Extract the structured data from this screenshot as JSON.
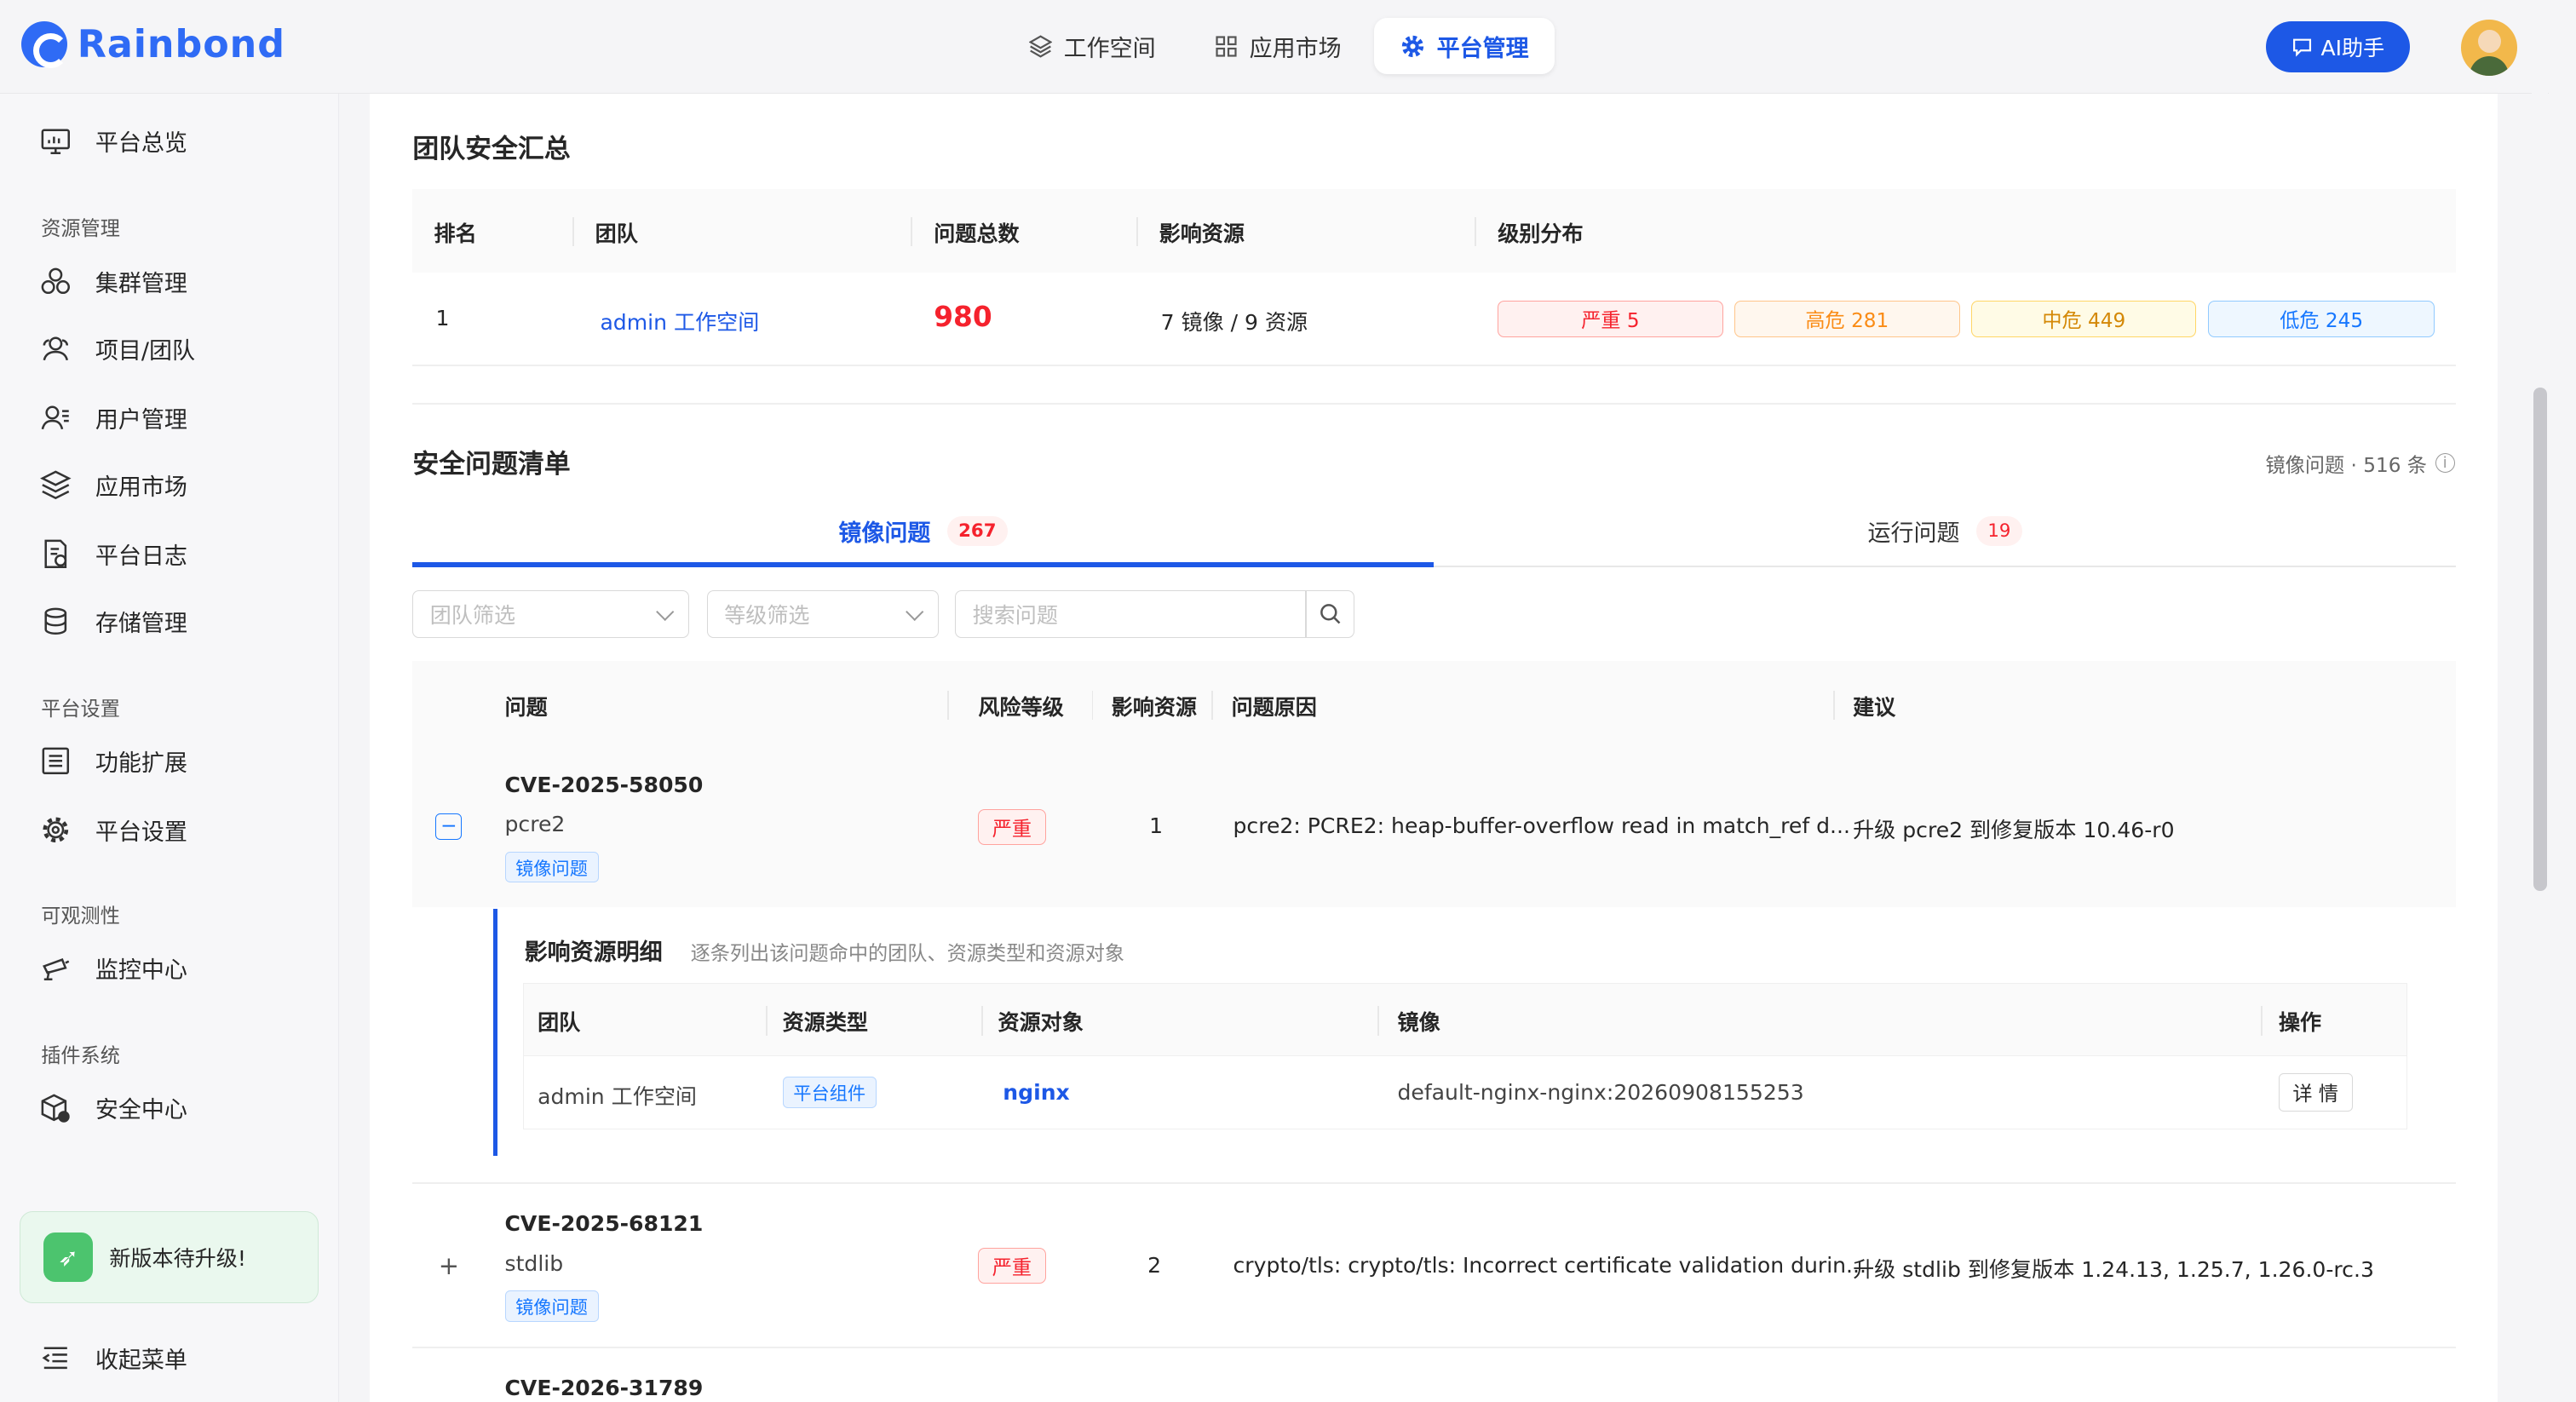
{
  "app": {
    "name": "Rainbond"
  },
  "topnav": [
    {
      "label": "工作空间",
      "icon": "layers-icon",
      "active": false
    },
    {
      "label": "应用市场",
      "icon": "grid-icon",
      "active": false
    },
    {
      "label": "平台管理",
      "icon": "gear-icon",
      "active": true
    }
  ],
  "ai_button": "AI助手",
  "sidebar": {
    "overview": "平台总览",
    "section_resources": "资源管理",
    "cluster": "集群管理",
    "project": "项目/团队",
    "users": "用户管理",
    "market": "应用市场",
    "logs": "平台日志",
    "storage": "存储管理",
    "section_settings": "平台设置",
    "extensions": "功能扩展",
    "settings": "平台设置",
    "section_observability": "可观测性",
    "monitor": "监控中心",
    "section_plugins": "插件系统",
    "security": "安全中心",
    "upgrade": "新版本待升级!",
    "collapse": "收起菜单"
  },
  "team_summary": {
    "title": "团队安全汇总",
    "columns": [
      "排名",
      "团队",
      "问题总数",
      "影响资源",
      "级别分布"
    ],
    "rows": [
      {
        "rank": "1",
        "team": "admin 工作空间",
        "total": "980",
        "resources": "7 镜像 / 9 资源",
        "critical": "严重 5",
        "high": "高危 281",
        "medium": "中危 449",
        "low": "低危 245"
      }
    ]
  },
  "issue_list": {
    "title": "安全问题清单",
    "meta": "镜像问题 · 516 条",
    "tabs": [
      {
        "label": "镜像问题",
        "count": "267",
        "active": true
      },
      {
        "label": "运行问题",
        "count": "19",
        "active": false
      }
    ],
    "filters": {
      "team_placeholder": "团队筛选",
      "level_placeholder": "等级筛选",
      "search_placeholder": "搜索问题"
    },
    "columns": [
      "问题",
      "风险等级",
      "影响资源",
      "问题原因",
      "建议"
    ],
    "rows": [
      {
        "cve": "CVE-2025-58050",
        "package": "pcre2",
        "type": "镜像问题",
        "level": "严重",
        "affected": "1",
        "reason": "pcre2: PCRE2: heap-buffer-overflow read in match_ref d...",
        "advice": "升级 pcre2 到修复版本 10.46-r0",
        "expanded": true
      },
      {
        "cve": "CVE-2025-68121",
        "package": "stdlib",
        "type": "镜像问题",
        "level": "严重",
        "affected": "2",
        "reason": "crypto/tls: crypto/tls: Incorrect certificate validation durin...",
        "advice": "升级 stdlib 到修复版本 1.24.13, 1.25.7, 1.26.0-rc.3",
        "expanded": false
      },
      {
        "cve": "CVE-2026-31789"
      }
    ],
    "detail": {
      "title": "影响资源明细",
      "subtitle": "逐条列出该问题命中的团队、资源类型和资源对象",
      "columns": [
        "团队",
        "资源类型",
        "资源对象",
        "镜像",
        "操作"
      ],
      "rows": [
        {
          "team": "admin 工作空间",
          "type": "平台组件",
          "object": "nginx",
          "image": "default-nginx-nginx:20260908155253",
          "action": "详 情"
        }
      ]
    }
  },
  "colors": {
    "brand": "#2f6bf5",
    "critical": "#f5222d",
    "high": "#fa8c16",
    "medium": "#d48806",
    "low": "#1677ff"
  }
}
